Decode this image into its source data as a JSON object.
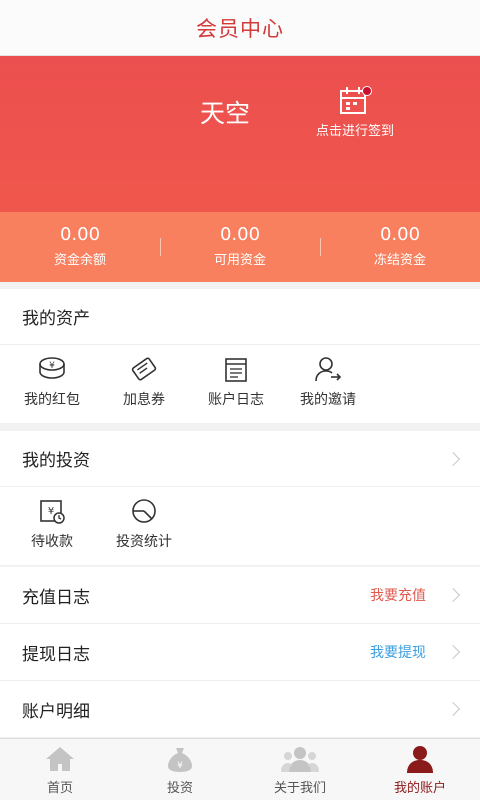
{
  "header": {
    "title": "会员中心"
  },
  "profile": {
    "username": "天空",
    "signin_label": "点击进行签到"
  },
  "stats": [
    {
      "value": "0.00",
      "label": "资金余额"
    },
    {
      "value": "0.00",
      "label": "可用资金"
    },
    {
      "value": "0.00",
      "label": "冻结资金"
    }
  ],
  "assets": {
    "title": "我的资产",
    "items": [
      {
        "label": "我的红包",
        "icon": "red-packet-icon"
      },
      {
        "label": "加息券",
        "icon": "coupon-icon"
      },
      {
        "label": "账户日志",
        "icon": "log-icon"
      },
      {
        "label": "我的邀请",
        "icon": "invite-icon"
      }
    ]
  },
  "investments": {
    "title": "我的投资",
    "items": [
      {
        "label": "待收款",
        "icon": "receivable-icon"
      },
      {
        "label": "投资统计",
        "icon": "stats-icon"
      }
    ]
  },
  "rows": [
    {
      "label": "充值日志",
      "action": "我要充值",
      "action_color": "#e05a4f"
    },
    {
      "label": "提现日志",
      "action": "我要提现",
      "action_color": "#3a9ee0"
    },
    {
      "label": "账户明细",
      "action": ""
    }
  ],
  "tabs": [
    {
      "label": "首页",
      "icon": "home-icon"
    },
    {
      "label": "投资",
      "icon": "money-bag-icon"
    },
    {
      "label": "关于我们",
      "icon": "people-icon"
    },
    {
      "label": "我的账户",
      "icon": "user-icon",
      "active": true
    }
  ],
  "colors": {
    "brand_red": "#ec4f4f",
    "stats_bar": "#f8805f",
    "active_tab": "#8b1b1b"
  }
}
